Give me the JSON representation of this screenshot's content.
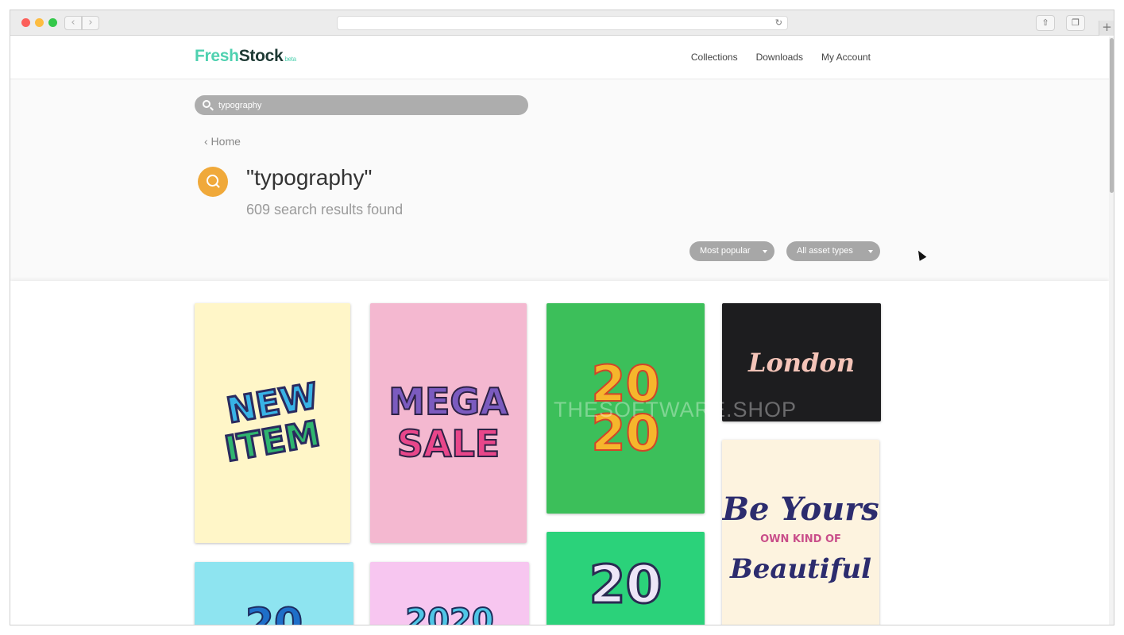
{
  "browser": {
    "back_glyph": "‹",
    "forward_glyph": "›",
    "reload_glyph": "↻",
    "share_glyph": "⇧",
    "tabs_glyph": "❐",
    "newtab_glyph": "+"
  },
  "site": {
    "logo_part1": "Fresh",
    "logo_part2": "Stock",
    "logo_badge": "beta",
    "nav": [
      "Collections",
      "Downloads",
      "My Account"
    ]
  },
  "search": {
    "value": "typography"
  },
  "breadcrumb": "‹ Home",
  "results": {
    "query_title": "\"typography\"",
    "count_text": "609 search results found"
  },
  "filters": {
    "sort_label": "Most popular",
    "type_label": "All asset types"
  },
  "watermark": "THESOFTWARE.SHOP",
  "assets": [
    {
      "lines": [
        "NEW",
        "ITEM"
      ]
    },
    {
      "lines": [
        "MEGA",
        "SALE"
      ]
    },
    {
      "lines": [
        "20",
        "20"
      ]
    },
    {
      "lines": [
        "London"
      ]
    },
    {
      "lines": [
        "Be Yours",
        "OWN KIND OF",
        "Beautiful"
      ]
    },
    {
      "lines": [
        "20"
      ]
    },
    {
      "lines": [
        "2020"
      ]
    },
    {
      "lines": [
        "20"
      ]
    }
  ],
  "colors": {
    "brand_teal": "#4fd1b0",
    "brand_dark": "#1e3a34",
    "accent_orange": "#f0a93a",
    "pill_gray": "#a7a7a7"
  }
}
